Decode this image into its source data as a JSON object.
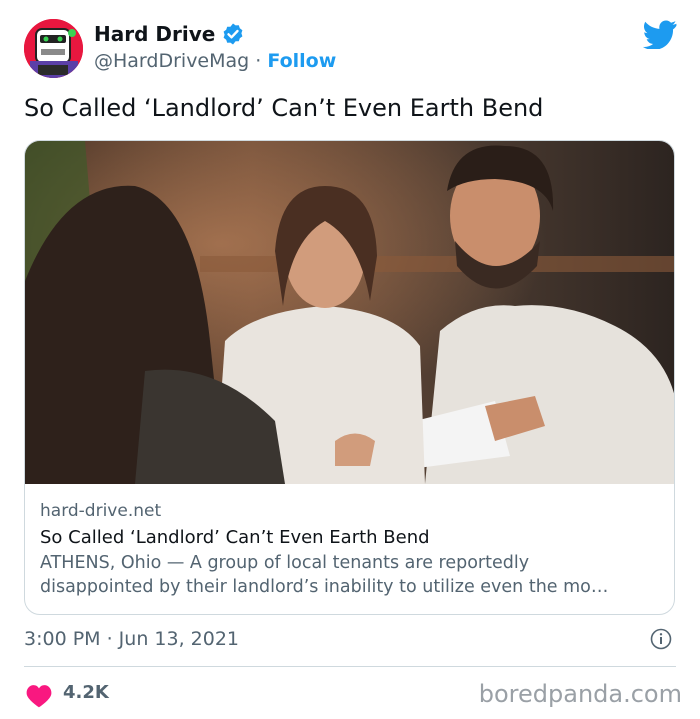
{
  "author": {
    "name": "Hard Drive",
    "handle": "@HardDriveMag",
    "separator": "·",
    "follow_label": "Follow",
    "avatar_icon": "robot-avatar-icon",
    "verified_icon": "verified-badge-icon"
  },
  "tweet": {
    "text": "So Called ‘Landlord’ Can’t Even Earth Bend",
    "timestamp": "3:00 PM · Jun 13, 2021",
    "likes": "4.2K"
  },
  "card": {
    "domain": "hard-drive.net",
    "title": "So Called ‘Landlord’ Can’t Even Earth Bend",
    "description_line1": "ATHENS, Ohio — A group of local tenants are reportedly",
    "description_line2": "disappointed by their landlord’s inability to utilize even the mo…"
  },
  "watermark": "boredpanda.com",
  "colors": {
    "accent": "#1d9bf0",
    "heart": "#f91880",
    "secondary_text": "#536471",
    "border": "#cfd9de"
  }
}
